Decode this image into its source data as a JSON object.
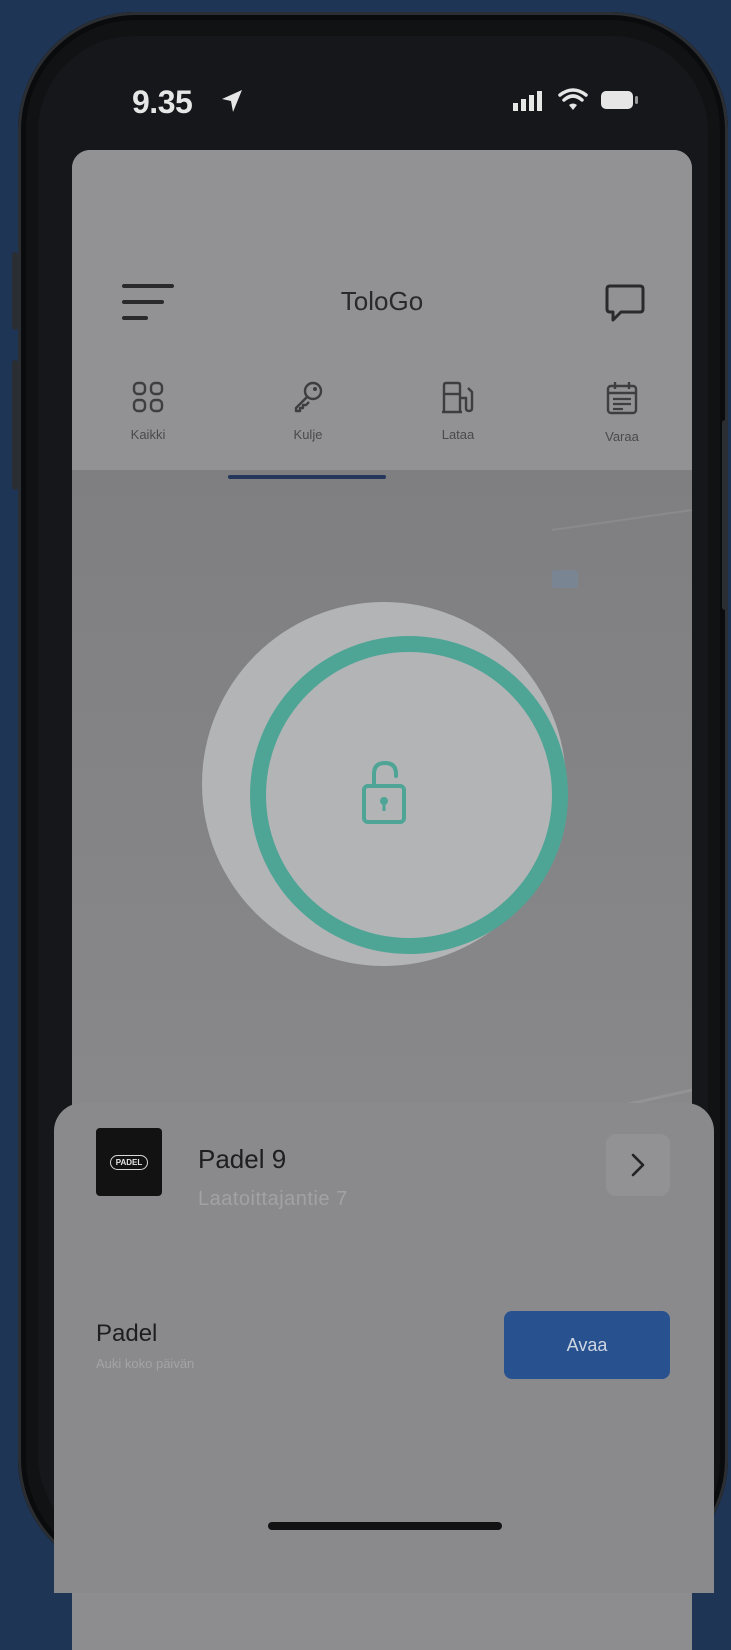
{
  "status_bar": {
    "time": "9.35"
  },
  "header": {
    "app_title": "ToloGo"
  },
  "tabs": [
    {
      "label": "Kaikki",
      "icon": "grid-icon",
      "active": false
    },
    {
      "label": "Kulje",
      "icon": "key-icon",
      "active": true
    },
    {
      "label": "Lataa",
      "icon": "ev-charger-icon",
      "active": false
    },
    {
      "label": "Varaa",
      "icon": "calendar-icon",
      "active": false
    }
  ],
  "lock": {
    "icon": "unlock-icon",
    "accent_color": "#4ea595"
  },
  "location": {
    "logo_text": "PADEL",
    "name": "Padel 9",
    "address": "Laatoittajantie 7"
  },
  "access_item": {
    "title": "Padel",
    "subtitle": "Auki koko päivän",
    "action_label": "Avaa"
  },
  "colors": {
    "primary_button": "#27518f",
    "tab_indicator": "#23375a",
    "background": "#1f3556"
  }
}
